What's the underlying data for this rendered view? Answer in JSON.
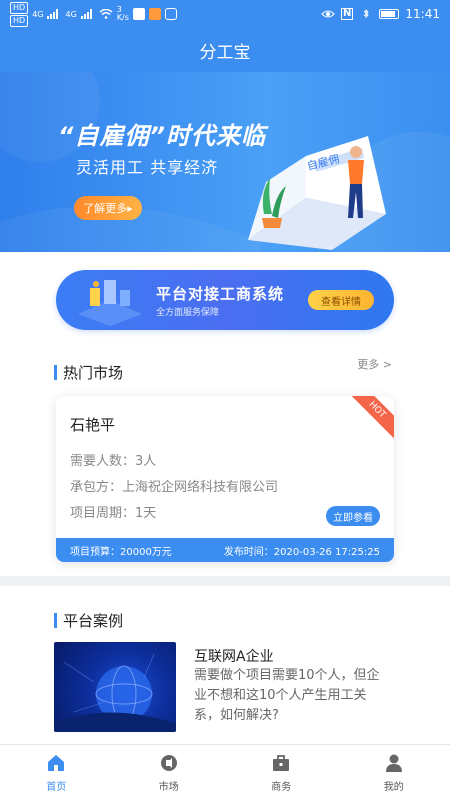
{
  "status_bar": {
    "network_chip_1": "HD",
    "network_chip_2": "HD",
    "signal_1": "4G",
    "signal_2": "4G",
    "speed": "3",
    "speed_unit": "K/s",
    "time": "11:41"
  },
  "app": {
    "title": "分工宝"
  },
  "hero": {
    "title": "“自雇佣”时代来临",
    "subtitle": "灵活用工 共享经济",
    "button": "了解更多▸",
    "book_text": "自雇佣"
  },
  "promo": {
    "title": "平台对接工商系统",
    "subtitle": "全方面服务保障",
    "button": "查看详情"
  },
  "hot_market": {
    "section_title": "热门市场",
    "more": "更多 >",
    "card": {
      "badge": "HOT",
      "name": "石艳平",
      "headcount_label": "需要人数：",
      "headcount_value": "3人",
      "contractor_label": "承包方：",
      "contractor_value": "上海祝企网络科技有限公司",
      "period_label": "项目周期：",
      "period_value": "1天",
      "join_button": "立即参看",
      "budget": "项目预算：20000万元",
      "published": "发布时间：2020-03-26 17:25:25"
    }
  },
  "cases": {
    "section_title": "平台案例",
    "items": [
      {
        "title": "互联网A企业",
        "description": "需要做个项目需要10个人，但企业不想和这10个人产生用工关系，如何解决?"
      }
    ]
  },
  "tabbar": {
    "items": [
      {
        "label": "首页",
        "icon": "home-icon",
        "active": true
      },
      {
        "label": "市场",
        "icon": "market-icon",
        "active": false
      },
      {
        "label": "商务",
        "icon": "briefcase-icon",
        "active": false
      },
      {
        "label": "我的",
        "icon": "user-icon",
        "active": false
      }
    ]
  },
  "colors": {
    "primary": "#3b8df0",
    "accent_orange": "#ff8a2b",
    "hot_red": "#f4654a"
  }
}
